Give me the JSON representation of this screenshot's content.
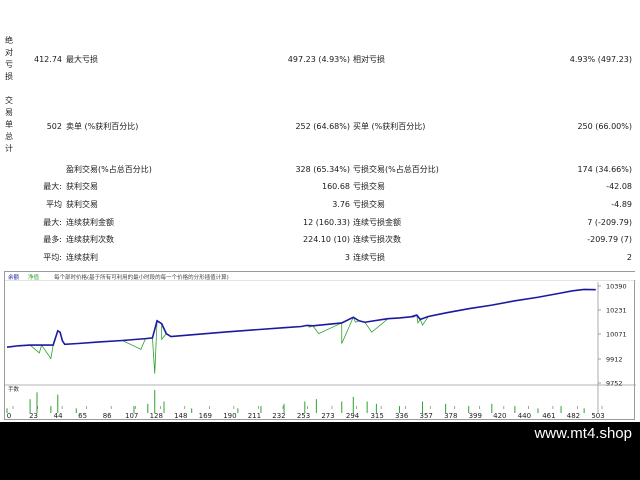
{
  "side_labels": {
    "drawdown": "绝对亏损",
    "trades": "交易单总计"
  },
  "rows": [
    {
      "c1": "412.74",
      "c2": "最大亏损",
      "c3": "497.23 (4.93%)",
      "c4": "相对亏损",
      "c5": "4.93% (497.23)"
    },
    {
      "c1": "502",
      "c2": "卖单 (%获利百分比)",
      "c3": "252 (64.68%)",
      "c4": "买单 (%获利百分比)",
      "c5": "250 (66.00%)"
    },
    {
      "c1": "",
      "c2": "盈利交易(%占总百分比)",
      "c3": "328 (65.34%)",
      "c4": "亏损交易(%占总百分比)",
      "c5": "174 (34.66%)"
    },
    {
      "c1": "最大:",
      "c2": "获利交易",
      "c3": "160.68",
      "c4": "亏损交易",
      "c5": "-42.08"
    },
    {
      "c1": "平均",
      "c2": "获利交易",
      "c3": "3.76",
      "c4": "亏损交易",
      "c5": "-4.89"
    },
    {
      "c1": "最大:",
      "c2": "连续获利金额",
      "c3": "12 (160.33)",
      "c4": "连续亏损金额",
      "c5": "7 (-209.79)"
    },
    {
      "c1": "最多:",
      "c2": "连续获利次数",
      "c3": "224.10 (10)",
      "c4": "连续亏损次数",
      "c5": "-209.79 (7)"
    },
    {
      "c1": "平均:",
      "c2": "连续获利",
      "c3": "3",
      "c4": "连续亏损",
      "c5": "2"
    }
  ],
  "chart_data": {
    "type": "line",
    "title": "余额 / 净值 / 每个部时价格(基于所有可利用的最小时段的每一个价格的分形插值计算)",
    "legend": [
      "余额",
      "净值"
    ],
    "colors": {
      "balance": "#1a1aa0",
      "equity": "#2ca02c",
      "volume": "#2ca02c"
    },
    "y_ticks": [
      "10390",
      "10231",
      "10071",
      "9912",
      "9752"
    ],
    "ylim": [
      9752,
      10390
    ],
    "x_ticks": [
      "0",
      "23",
      "44",
      "65",
      "86",
      "107",
      "128",
      "148",
      "169",
      "190",
      "211",
      "232",
      "253",
      "273",
      "294",
      "315",
      "336",
      "357",
      "378",
      "399",
      "420",
      "440",
      "461",
      "482",
      "503"
    ],
    "xlim": [
      0,
      512
    ],
    "volume_label": "手数",
    "balance": [
      [
        0,
        9975
      ],
      [
        10,
        9985
      ],
      [
        20,
        9990
      ],
      [
        30,
        9990
      ],
      [
        40,
        9990
      ],
      [
        44,
        10090
      ],
      [
        46,
        10080
      ],
      [
        48,
        10020
      ],
      [
        50,
        9995
      ],
      [
        60,
        10000
      ],
      [
        80,
        10012
      ],
      [
        100,
        10022
      ],
      [
        120,
        10035
      ],
      [
        126,
        10040
      ],
      [
        130,
        10160
      ],
      [
        134,
        10140
      ],
      [
        138,
        10070
      ],
      [
        142,
        10050
      ],
      [
        160,
        10062
      ],
      [
        190,
        10082
      ],
      [
        220,
        10100
      ],
      [
        240,
        10112
      ],
      [
        255,
        10120
      ],
      [
        260,
        10128
      ],
      [
        265,
        10125
      ],
      [
        290,
        10145
      ],
      [
        300,
        10185
      ],
      [
        305,
        10160
      ],
      [
        310,
        10150
      ],
      [
        330,
        10175
      ],
      [
        340,
        10180
      ],
      [
        350,
        10188
      ],
      [
        355,
        10200
      ],
      [
        358,
        10170
      ],
      [
        365,
        10190
      ],
      [
        380,
        10215
      ],
      [
        400,
        10245
      ],
      [
        420,
        10270
      ],
      [
        440,
        10300
      ],
      [
        460,
        10325
      ],
      [
        480,
        10355
      ],
      [
        490,
        10370
      ],
      [
        500,
        10380
      ],
      [
        510,
        10378
      ]
    ],
    "equity_dips": [
      [
        28,
        9935
      ],
      [
        38,
        9895
      ],
      [
        116,
        9960
      ],
      [
        128,
        9790
      ],
      [
        134,
        10030
      ],
      [
        240,
        10110
      ],
      [
        262,
        10115
      ],
      [
        270,
        10070
      ],
      [
        290,
        10000
      ],
      [
        302,
        10150
      ],
      [
        316,
        10080
      ],
      [
        352,
        10185
      ],
      [
        356,
        10145
      ],
      [
        360,
        10130
      ]
    ],
    "volume": [
      [
        0,
        0.2
      ],
      [
        20,
        0.6
      ],
      [
        26,
        0.9
      ],
      [
        38,
        0.3
      ],
      [
        44,
        0.8
      ],
      [
        60,
        0.2
      ],
      [
        110,
        0.3
      ],
      [
        122,
        0.4
      ],
      [
        128,
        1.0
      ],
      [
        136,
        0.5
      ],
      [
        160,
        0.2
      ],
      [
        200,
        0.2
      ],
      [
        220,
        0.3
      ],
      [
        240,
        0.4
      ],
      [
        258,
        0.5
      ],
      [
        268,
        0.6
      ],
      [
        290,
        0.5
      ],
      [
        300,
        0.7
      ],
      [
        312,
        0.5
      ],
      [
        320,
        0.4
      ],
      [
        340,
        0.3
      ],
      [
        360,
        0.5
      ],
      [
        380,
        0.4
      ],
      [
        400,
        0.3
      ],
      [
        420,
        0.4
      ],
      [
        440,
        0.3
      ],
      [
        460,
        0.2
      ],
      [
        480,
        0.3
      ],
      [
        500,
        0.2
      ]
    ]
  },
  "footer": {
    "brand": "www.mt4.shop"
  }
}
